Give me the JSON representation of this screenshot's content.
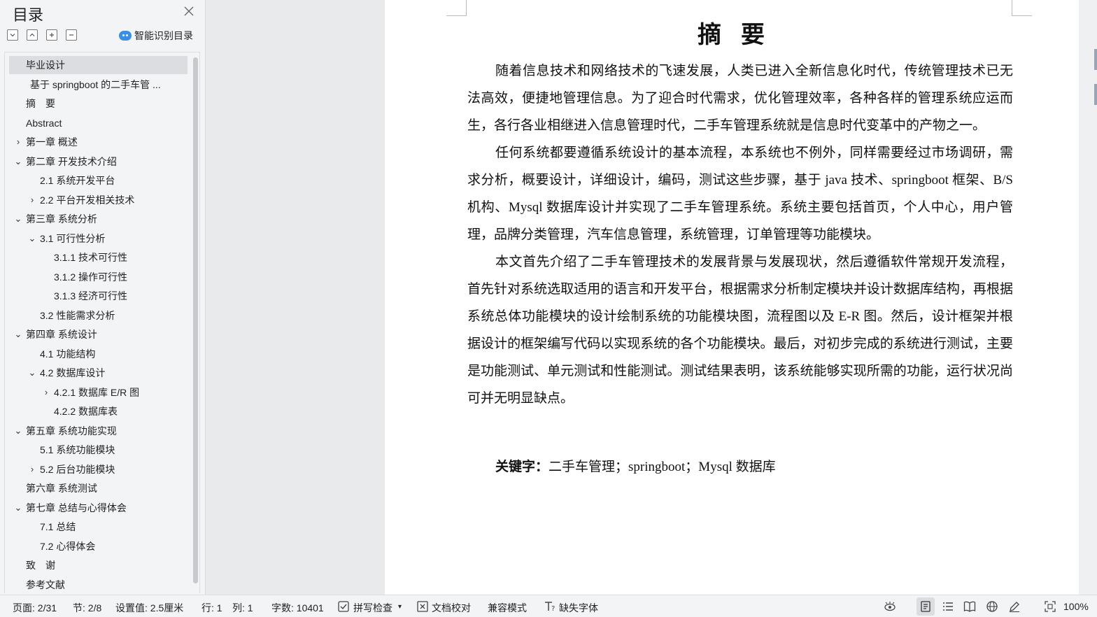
{
  "toc": {
    "title": "目录",
    "smart_toc_label": "智能识别目录",
    "items": [
      {
        "label": "毕业设计",
        "level": 0,
        "arrow": "",
        "selected": true
      },
      {
        "label": "基于 springboot 的二手车管 ...",
        "level": 0.3,
        "arrow": ""
      },
      {
        "label": "摘　要",
        "level": 0,
        "arrow": ""
      },
      {
        "label": "Abstract",
        "level": 0,
        "arrow": ""
      },
      {
        "label": "第一章  概述",
        "level": 0,
        "arrow": "›"
      },
      {
        "label": "第二章  开发技术介绍",
        "level": 0,
        "arrow": "⌄"
      },
      {
        "label": "2.1  系统开发平台",
        "level": 1,
        "arrow": ""
      },
      {
        "label": "2.2  平台开发相关技术",
        "level": 1,
        "arrow": "›"
      },
      {
        "label": "第三章  系统分析",
        "level": 0,
        "arrow": "⌄"
      },
      {
        "label": "3.1  可行性分析",
        "level": 1,
        "arrow": "⌄"
      },
      {
        "label": "3.1.1 技术可行性",
        "level": 2,
        "arrow": ""
      },
      {
        "label": "3.1.2 操作可行性",
        "level": 2,
        "arrow": ""
      },
      {
        "label": "3.1.3 经济可行性",
        "level": 2,
        "arrow": ""
      },
      {
        "label": "3.2 性能需求分析",
        "level": 1,
        "arrow": ""
      },
      {
        "label": "第四章  系统设计",
        "level": 0,
        "arrow": "⌄"
      },
      {
        "label": "4.1 功能结构",
        "level": 1,
        "arrow": ""
      },
      {
        "label": "4.2  数据库设计",
        "level": 1,
        "arrow": "⌄"
      },
      {
        "label": "4.2.1  数据库 E/R 图",
        "level": 2,
        "arrow": "›"
      },
      {
        "label": "4.2.2  数据库表",
        "level": 2,
        "arrow": ""
      },
      {
        "label": "第五章  系统功能实现",
        "level": 0,
        "arrow": "⌄"
      },
      {
        "label": "5.1 系统功能模块",
        "level": 1,
        "arrow": ""
      },
      {
        "label": "5.2 后台功能模块",
        "level": 1,
        "arrow": "›"
      },
      {
        "label": "第六章  系统测试",
        "level": 0,
        "arrow": ""
      },
      {
        "label": "第七章  总结与心得体会",
        "level": 0,
        "arrow": "⌄"
      },
      {
        "label": "7.1 总结",
        "level": 1,
        "arrow": ""
      },
      {
        "label": "7.2 心得体会",
        "level": 1,
        "arrow": ""
      },
      {
        "label": "致　谢",
        "level": 0,
        "arrow": ""
      },
      {
        "label": "参考文献",
        "level": 0,
        "arrow": ""
      }
    ]
  },
  "document": {
    "title": "摘要",
    "paragraphs": [
      "随着信息技术和网络技术的飞速发展，人类已进入全新信息化时代，传统管理技术已无法高效，便捷地管理信息。为了迎合时代需求，优化管理效率，各种各样的管理系统应运而生，各行各业相继进入信息管理时代，二手车管理系统就是信息时代变革中的产物之一。",
      "任何系统都要遵循系统设计的基本流程，本系统也不例外，同样需要经过市场调研，需求分析，概要设计，详细设计，编码，测试这些步骤，基于 java 技术、springboot 框架、B/S 机构、Mysql 数据库设计并实现了二手车管理系统。系统主要包括首页，个人中心，用户管理，品牌分类管理，汽车信息管理，系统管理，订单管理等功能模块。",
      "本文首先介绍了二手车管理技术的发展背景与发展现状，然后遵循软件常规开发流程，首先针对系统选取适用的语言和开发平台，根据需求分析制定模块并设计数据库结构，再根据系统总体功能模块的设计绘制系统的功能模块图，流程图以及 E-R 图。然后，设计框架并根据设计的框架编写代码以实现系统的各个功能模块。最后，对初步完成的系统进行测试，主要是功能测试、单元测试和性能测试。测试结果表明，该系统能够实现所需的功能，运行状况尚可并无明显缺点。"
    ],
    "keywords_label": "关键字：",
    "keywords": "二手车管理；springboot；Mysql 数据库"
  },
  "status": {
    "page": "页面: 2/31",
    "section": "节: 2/8",
    "setting": "设置值: 2.5厘米",
    "row": "行: 1",
    "col": "列: 1",
    "word_count": "字数: 10401",
    "spell_check": "拼写检查",
    "proofread": "文档校对",
    "compat_mode": "兼容模式",
    "missing_fonts": "缺失字体",
    "zoom": "100%"
  }
}
